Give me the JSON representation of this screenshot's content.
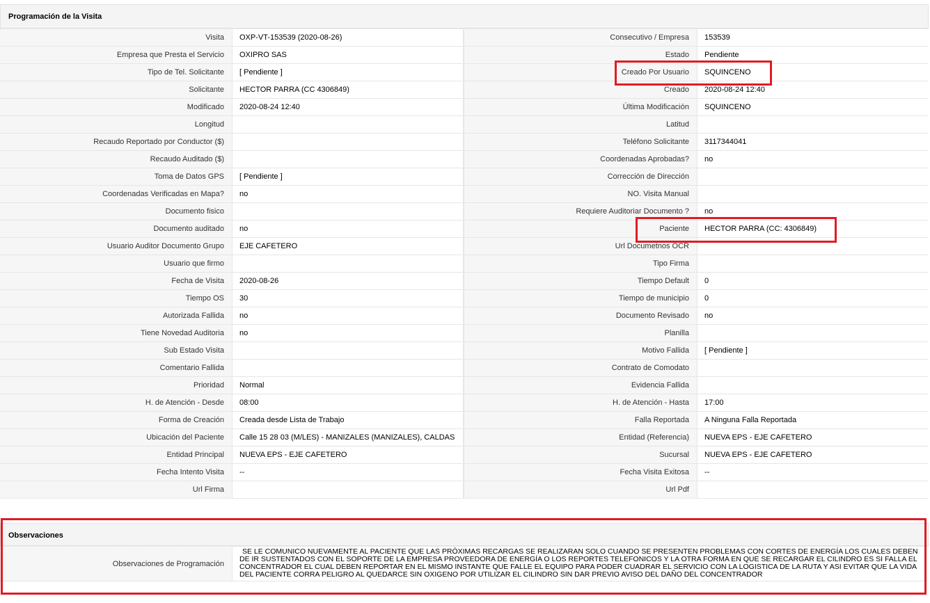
{
  "sections": {
    "programacion_title": "Programación de la Visita",
    "observaciones_title": "Observaciones"
  },
  "rows": [
    {
      "l1": "Visita",
      "v1": "OXP-VT-153539 (2020-08-26)",
      "l2": "Consecutivo / Empresa",
      "v2": "153539"
    },
    {
      "l1": "Empresa que Presta el Servicio",
      "v1": "OXIPRO SAS",
      "l2": "Estado",
      "v2": "Pendiente"
    },
    {
      "l1": "Tipo de Tel. Solicitante",
      "v1": "[ Pendiente ]",
      "l2": "Creado Por Usuario",
      "v2": "SQUINCENO"
    },
    {
      "l1": "Solicitante",
      "v1": "HECTOR PARRA (CC 4306849)",
      "l2": "Creado",
      "v2": "2020-08-24 12:40"
    },
    {
      "l1": "Modificado",
      "v1": "2020-08-24 12:40",
      "l2": "Última Modificación",
      "v2": " SQUINCENO"
    },
    {
      "l1": "Longitud",
      "v1": "",
      "l2": "Latitud",
      "v2": ""
    },
    {
      "l1": "Recaudo Reportado por Conductor ($)",
      "v1": "",
      "l2": "Teléfono Solicitante",
      "v2": "3117344041"
    },
    {
      "l1": "Recaudo Auditado ($)",
      "v1": "",
      "l2": "Coordenadas Aprobadas?",
      "v2": " no"
    },
    {
      "l1": "Toma de Datos GPS",
      "v1": "[ Pendiente ]",
      "l2": "Corrección de Dirección",
      "v2": ""
    },
    {
      "l1": "Coordenadas Verificadas en Mapa?",
      "v1": " no",
      "l2": "NO. Visita Manual",
      "v2": ""
    },
    {
      "l1": "Documento fisico",
      "v1": "",
      "l2": "Requiere Auditoriar Documento ?",
      "v2": " no"
    },
    {
      "l1": "Documento auditado",
      "v1": " no",
      "l2": "Paciente",
      "v2": "HECTOR PARRA (CC: 4306849)"
    },
    {
      "l1": "Usuario Auditor Documento Grupo",
      "v1": "EJE CAFETERO",
      "l2": "Url Documetnos OCR",
      "v2": ""
    },
    {
      "l1": "Usuario que firmo",
      "v1": "",
      "l2": "Tipo Firma",
      "v2": ""
    },
    {
      "l1": "Fecha de Visita",
      "v1": " 2020-08-26",
      "l2": "Tiempo Default",
      "v2": "0"
    },
    {
      "l1": "Tiempo OS",
      "v1": "30",
      "l2": "Tiempo de municipio",
      "v2": "0"
    },
    {
      "l1": "Autorizada Fallida",
      "v1": " no",
      "l2": "Documento Revisado",
      "v2": " no"
    },
    {
      "l1": "Tiene Novedad Auditoria",
      "v1": " no",
      "l2": "Planilla",
      "v2": ""
    },
    {
      "l1": "Sub Estado Visita",
      "v1": "",
      "l2": "Motivo Fallida",
      "v2": "[ Pendiente ]"
    },
    {
      "l1": "Comentario Fallida",
      "v1": "",
      "l2": "Contrato de Comodato",
      "v2": ""
    },
    {
      "l1": "Prioridad",
      "v1": "Normal",
      "l2": "Evidencia Fallida",
      "v2": ""
    },
    {
      "l1": "H. de Atención - Desde",
      "v1": "08:00",
      "l2": "H. de Atención - Hasta",
      "v2": "17:00"
    },
    {
      "l1": "Forma de Creación",
      "v1": "Creada desde Lista de Trabajo",
      "l2": "Falla Reportada",
      "v2": "A Ninguna Falla Reportada"
    },
    {
      "l1": "Ubicación del Paciente",
      "v1": "Calle 15 28 03 (M/LES) - MANIZALES (MANIZALES), CALDAS",
      "l2": "Entidad (Referencia)",
      "v2": "NUEVA EPS - EJE CAFETERO"
    },
    {
      "l1": "Entidad Principal",
      "v1": "NUEVA EPS - EJE CAFETERO",
      "l2": "Sucursal",
      "v2": "NUEVA EPS - EJE CAFETERO"
    },
    {
      "l1": "Fecha Intento Visita",
      "v1": " --",
      "l2": "Fecha Visita Exitosa",
      "v2": " --"
    },
    {
      "l1": "Url Firma",
      "v1": "",
      "l2": "Url Pdf",
      "v2": ""
    }
  ],
  "observaciones": {
    "label": "Observaciones de Programación",
    "text": "SE LE COMUNICO NUEVAMENTE AL PACIENTE QUE LAS PRÓXIMAS RECARGAS SE REALIZARAN SOLO CUANDO SE PRESENTEN PROBLEMAS CON CORTES DE ENERGÍA LOS CUALES DEBEN DE IR SUSTENTADOS CON EL SOPORTE DE LA EMPRESA PROVEEDORA DE ENERGÍA O LOS REPORTES TELEFONICOS Y LA OTRA FORMA EN QUE SE RECARGAR EL CILINDRO ES SI FALLA EL CONCENTRADOR EL CUAL DEBEN REPORTAR EN EL MISMO INSTANTE QUE FALLE EL EQUIPO PARA PODER CUADRAR EL SERVICIO CON LA LOGISTICA DE LA RUTA Y ASI EVITAR QUE LA VIDA DEL PACIENTE CORRA PELIGRO AL QUEDARCE SIN OXIGENO POR UTILIZAR EL CILINDRO SIN DAR PREVIO AVISO DEL DAÑO DEL CONCENTRADOR"
  },
  "highlight_color": "#e01b24"
}
